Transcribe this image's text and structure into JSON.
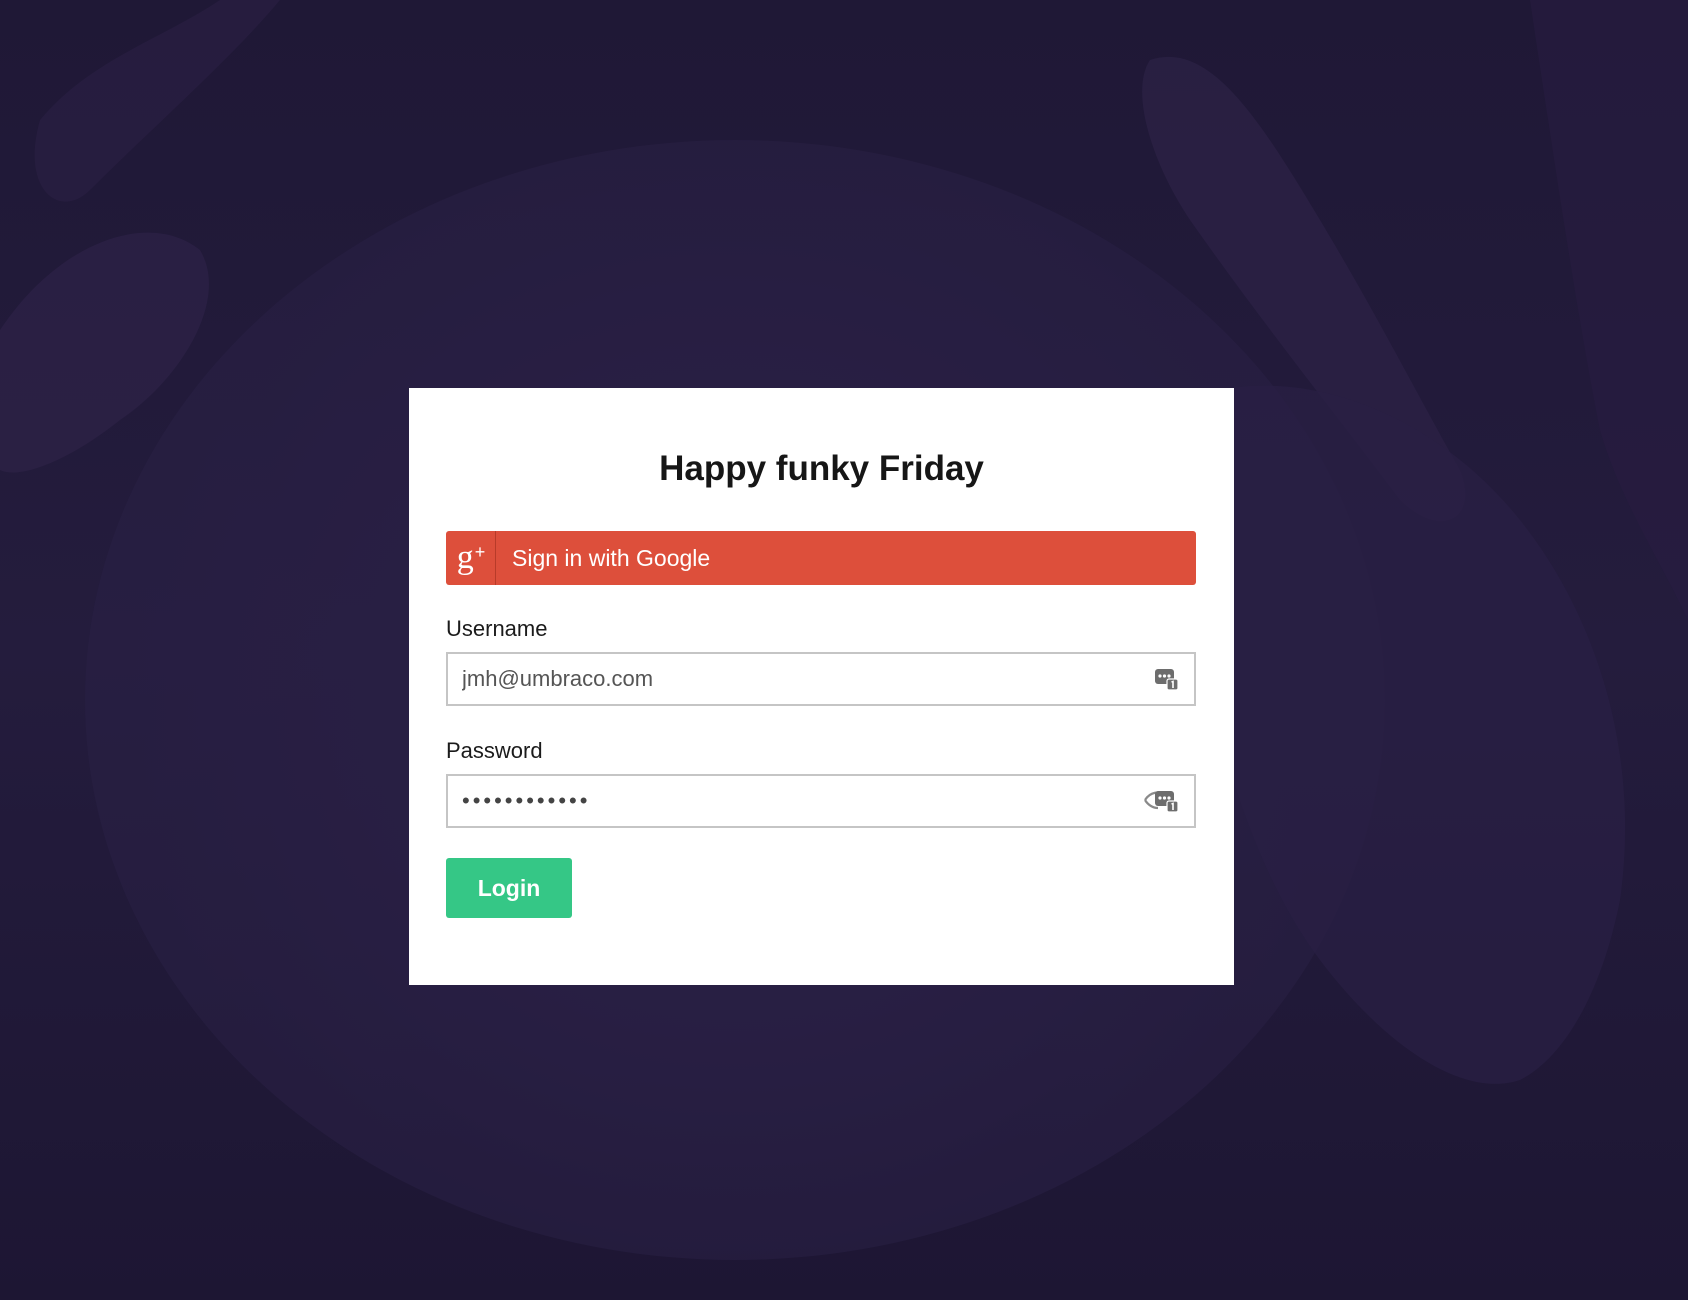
{
  "page": {
    "background_color": "#221a3a",
    "card_color": "#ffffff"
  },
  "login": {
    "title": "Happy funky Friday",
    "google_button": {
      "icon": "google-plus-icon",
      "icon_text": "g",
      "icon_plus": "+",
      "label": "Sign in with Google",
      "color": "#dd4f3b"
    },
    "username": {
      "label": "Username",
      "value": "jmh@umbraco.com",
      "icon": "password-manager-icon"
    },
    "password": {
      "label": "Password",
      "value": "••••••••••••",
      "icons": [
        "eye-icon",
        "password-manager-icon"
      ]
    },
    "login_button": {
      "label": "Login",
      "color": "#35c786"
    }
  }
}
